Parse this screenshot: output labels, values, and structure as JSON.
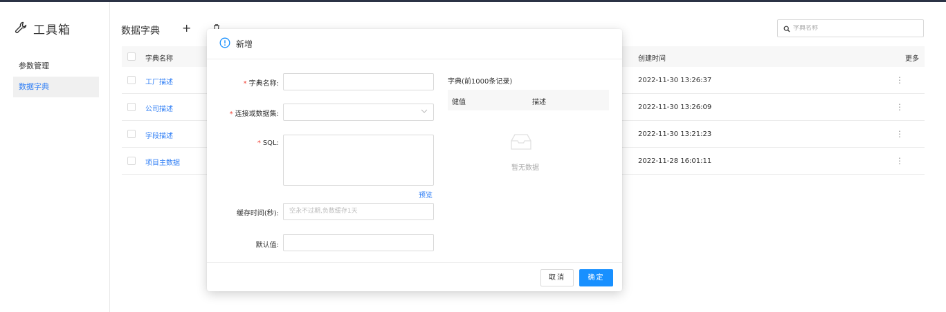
{
  "sidebar": {
    "brand": "工具箱",
    "items": [
      {
        "label": "参数管理"
      },
      {
        "label": "数据字典"
      }
    ]
  },
  "main": {
    "title": "数据字典",
    "add_symbol": "+",
    "search_placeholder": "字典名称",
    "table": {
      "headers": {
        "name": "字典名称",
        "created": "创建时间",
        "more": "更多"
      },
      "rows": [
        {
          "name": "工厂描述",
          "created": "2022-11-30 13:26:37",
          "more": "⋮"
        },
        {
          "name": "公司描述",
          "created": "2022-11-30 13:26:09",
          "more": "⋮"
        },
        {
          "name": "字段描述",
          "created": "2022-11-30 13:21:23",
          "more": "⋮"
        },
        {
          "name": "项目主数据",
          "created": "2022-11-28 16:01:11",
          "more": "⋮"
        }
      ]
    }
  },
  "modal": {
    "title": "新增",
    "required_mark": "*",
    "fields": {
      "dict_name_label": "字典名称:",
      "source_label": "连接或数据集:",
      "sql_label": "SQL:",
      "cache_label": "缓存时间(秒):",
      "cache_placeholder": "空永不过期,负数缓存1天",
      "default_label": "默认值:"
    },
    "preview_link": "预览",
    "dict_panel": {
      "title": "字典(前1000条记录)",
      "col_key": "健值",
      "col_desc": "描述",
      "empty_text": "暂无数据"
    },
    "buttons": {
      "cancel": "取消",
      "ok": "确定"
    }
  },
  "colors": {
    "accent": "#1890ff",
    "link": "#2f7ef5",
    "required": "#f04134"
  }
}
